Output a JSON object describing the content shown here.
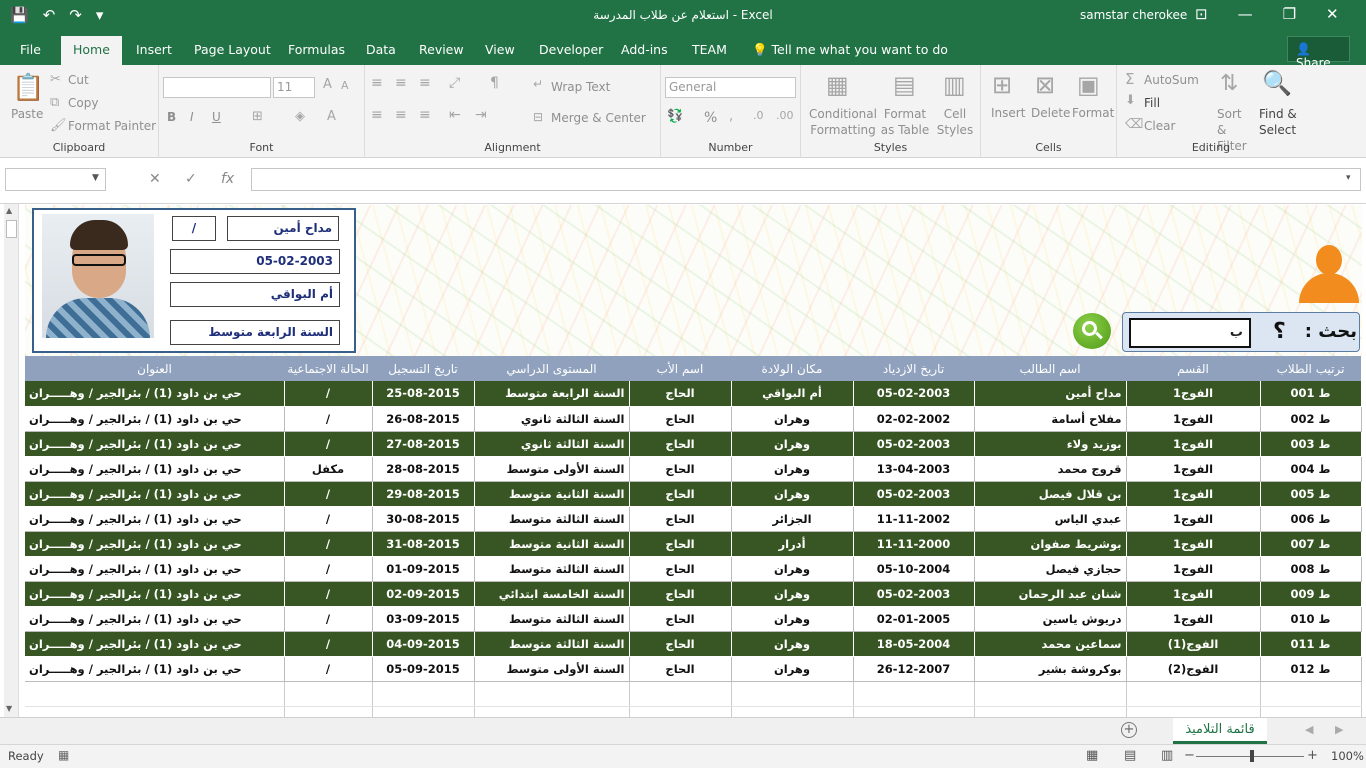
{
  "window": {
    "title": "استعلام عن طلاب المدرسة  -  Excel",
    "user": "samstar cherokee",
    "qat": [
      "💾",
      "↶",
      "↷",
      "▾"
    ],
    "controls": [
      "⊡",
      "—",
      "❐",
      "✕"
    ]
  },
  "menu": {
    "tabs": [
      "File",
      "Home",
      "Insert",
      "Page Layout",
      "Formulas",
      "Data",
      "Review",
      "View",
      "Developer",
      "Add-ins",
      "TEAM"
    ],
    "active": "Home",
    "tell_me": "Tell me what you want to do",
    "share": "Share"
  },
  "ribbon": {
    "clipboard": {
      "label": "Clipboard",
      "paste": "Paste",
      "cut": "Cut",
      "copy": "Copy",
      "format_painter": "Format Painter"
    },
    "font": {
      "label": "Font",
      "size": "11",
      "bold": "B",
      "italic": "I",
      "underline": "U"
    },
    "alignment": {
      "label": "Alignment",
      "wrap_text": "Wrap Text",
      "merge_center": "Merge & Center"
    },
    "number": {
      "label": "Number",
      "format": "General",
      "percent": "%"
    },
    "styles": {
      "label": "Styles",
      "conditional": "Conditional Formatting",
      "format_table": "Format as Table",
      "cell_styles": "Cell Styles"
    },
    "cells": {
      "label": "Cells",
      "insert": "Insert",
      "delete": "Delete",
      "format": "Format"
    },
    "editing": {
      "label": "Editing",
      "autosum": "AutoSum",
      "fill": "Fill",
      "clear": "Clear",
      "sort_filter": "Sort & Filter",
      "find_select": "Find & Select"
    }
  },
  "formula_bar": {
    "name_box": "",
    "formula": ""
  },
  "card": {
    "name": "مداح أمين",
    "status": "/",
    "birth_date": "05-02-2003",
    "birth_place": "أم البواقي",
    "level": "السنة الرابعة متوسط"
  },
  "search": {
    "label": "بحث  :",
    "qmark": "؟",
    "value": "ب"
  },
  "table": {
    "headers": [
      "ترتيب الطلاب",
      "القسم",
      "اسم الطالب",
      "تاريخ الازدياد",
      "مكان الولادة",
      "اسم الأب",
      "المستوى الدراسي",
      "تاريخ التسجيل",
      "الحالة الاجتماعية",
      "العنوان"
    ],
    "rows": [
      [
        "ط 001",
        "الفوج1",
        "مداح أمين",
        "05-02-2003",
        "أم البواقي",
        "الحاج",
        "السنة الرابعة متوسط",
        "25-08-2015",
        "/",
        "حي بن داود (1) / بئرالجير / وهـــــران"
      ],
      [
        "ط 002",
        "الفوج1",
        "مفلاح أسامة",
        "02-02-2002",
        "وهران",
        "الحاج",
        "السنة الثالثة ثانوي",
        "26-08-2015",
        "/",
        "حي بن داود (1) / بئرالجير / وهـــــران"
      ],
      [
        "ط 003",
        "الفوج1",
        "بوزيد ولاء",
        "05-02-2003",
        "وهران",
        "الحاج",
        "السنة الثالثة ثانوي",
        "27-08-2015",
        "/",
        "حي بن داود (1) / بئرالجير / وهـــــران"
      ],
      [
        "ط 004",
        "الفوج1",
        "قروج محمد",
        "13-04-2003",
        "وهران",
        "الحاج",
        "السنة الأولى متوسط",
        "28-08-2015",
        "مكفل",
        "حي بن داود (1) / بئرالجير / وهـــــران"
      ],
      [
        "ط 005",
        "الفوج1",
        "بن قلال فيصل",
        "05-02-2003",
        "وهران",
        "الحاج",
        "السنة الثانية متوسط",
        "29-08-2015",
        "/",
        "حي بن داود (1) / بئرالجير / وهـــــران"
      ],
      [
        "ط 006",
        "الفوج1",
        "عبدي الياس",
        "11-11-2002",
        "الجزائر",
        "الحاج",
        "السنة الثالثة متوسط",
        "30-08-2015",
        "/",
        "حي بن داود (1) / بئرالجير / وهـــــران"
      ],
      [
        "ط 007",
        "الفوج1",
        "بوشريط صفوان",
        "11-11-2000",
        "أدرار",
        "الحاج",
        "السنة الثانية متوسط",
        "31-08-2015",
        "/",
        "حي بن داود (1) / بئرالجير / وهـــــران"
      ],
      [
        "ط 008",
        "الفوج1",
        "حجازي فيصل",
        "05-10-2004",
        "وهران",
        "الحاج",
        "السنة الثالثة متوسط",
        "01-09-2015",
        "/",
        "حي بن داود (1) / بئرالجير / وهـــــران"
      ],
      [
        "ط 009",
        "الفوج1",
        "شنان عبد الرحمان",
        "05-02-2003",
        "وهران",
        "الحاج",
        "السنة الخامسة ابتدائي",
        "02-09-2015",
        "/",
        "حي بن داود (1) / بئرالجير / وهـــــران"
      ],
      [
        "ط 010",
        "الفوج1",
        "دريوش ياسين",
        "02-01-2005",
        "وهران",
        "الحاج",
        "السنة الثالثة متوسط",
        "03-09-2015",
        "/",
        "حي بن داود (1) / بئرالجير / وهـــــران"
      ],
      [
        "ط 011",
        "الفوج(1)",
        "سماعين محمد",
        "18-05-2004",
        "وهران",
        "الحاج",
        "السنة الثالثة متوسط",
        "04-09-2015",
        "/",
        "حي بن داود (1) / بئرالجير / وهـــــران"
      ],
      [
        "ط 012",
        "الفوج(2)",
        "بوكروشة بشير",
        "26-12-2007",
        "وهران",
        "الحاج",
        "السنة الأولى متوسط",
        "05-09-2015",
        "/",
        "حي بن داود (1) / بئرالجير / وهـــــران"
      ]
    ]
  },
  "sheet_tab": "قائمة التلاميذ",
  "status": {
    "ready": "Ready",
    "zoom": "100%"
  },
  "colors": {
    "excel_green": "#217346",
    "row_dark": "#375623",
    "header_blue": "#8fa1bd",
    "card_border": "#385e8a",
    "accent_orange": "#f28c1e"
  }
}
